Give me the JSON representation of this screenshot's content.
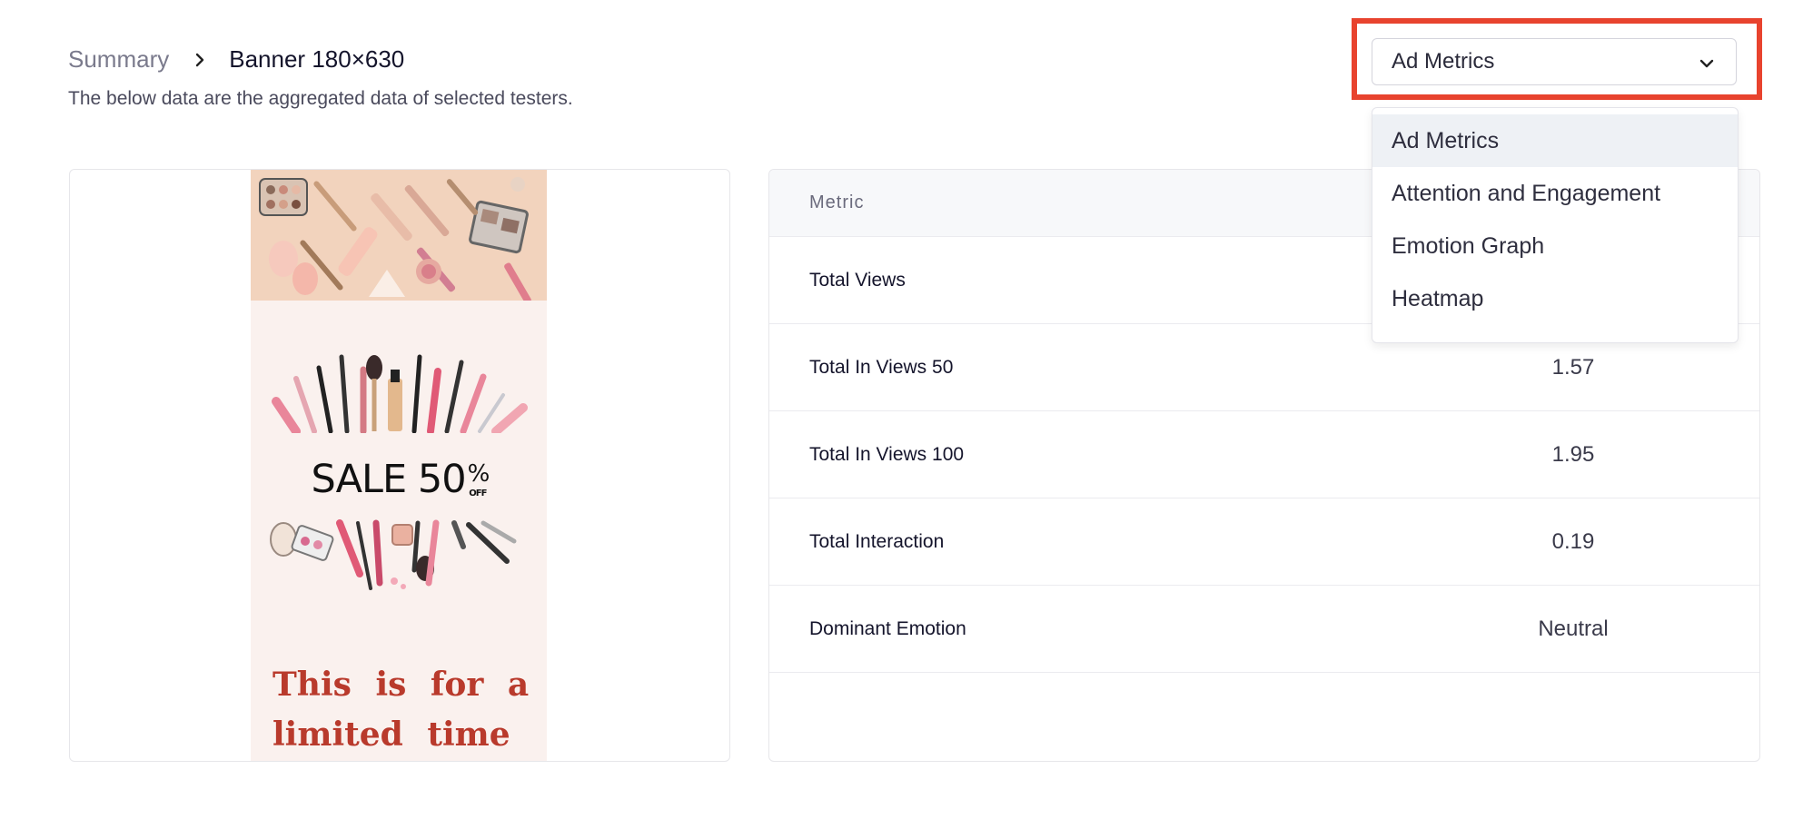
{
  "breadcrumb": {
    "parent": "Summary",
    "current": "Banner 180×630"
  },
  "subtitle": "The below data are the aggregated data of selected testers.",
  "banner": {
    "sale_main": "SALE 50",
    "sale_pct": "%",
    "sale_off": "OFF",
    "tagline": "This is for a limited time"
  },
  "metrics": {
    "header": "Metric",
    "rows": [
      {
        "name": "Total Views",
        "value": ""
      },
      {
        "name": "Total In Views 50",
        "value": "1.57"
      },
      {
        "name": "Total In Views 100",
        "value": "1.95"
      },
      {
        "name": "Total Interaction",
        "value": "0.19"
      },
      {
        "name": "Dominant Emotion",
        "value": "Neutral"
      }
    ]
  },
  "view_select": {
    "selected": "Ad Metrics",
    "options": [
      "Ad Metrics",
      "Attention and Engagement",
      "Emotion Graph",
      "Heatmap"
    ]
  },
  "colors": {
    "highlight": "#e8432e",
    "tagline": "#b93a2c",
    "menu_active": "#eef1f5"
  }
}
